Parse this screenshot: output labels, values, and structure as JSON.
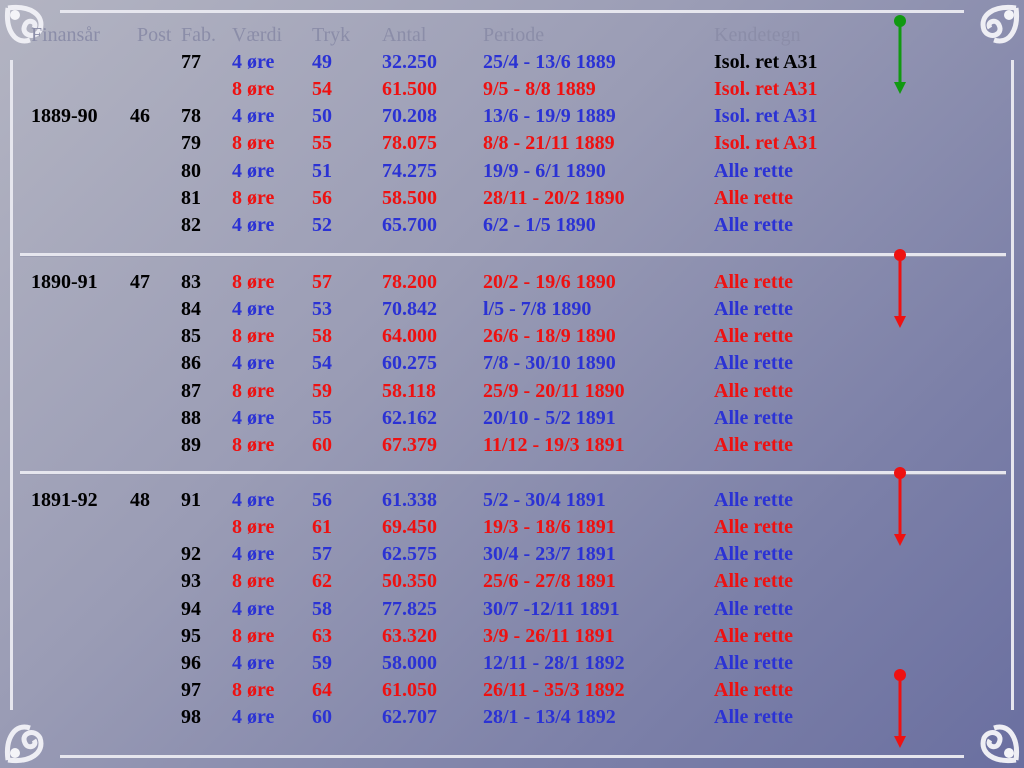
{
  "colors": {
    "blue": "#2b32d4",
    "red": "#ee1111",
    "black": "#000000",
    "green": "#119911",
    "header": "#8b8da8"
  },
  "header": {
    "finansaar": "Finansår",
    "post": "Post",
    "fab": "Fab.",
    "vaerdi": "Værdi",
    "tryk": "Tryk",
    "antal": "Antal",
    "periode": "Periode",
    "kendetegn": "Kendetegn"
  },
  "rows": [
    {
      "fin": "",
      "post": "",
      "fab": "77",
      "val": "4 øre",
      "tryk": "49",
      "antal": "32.250",
      "per": "25/4 - 13/6 1889",
      "ken": "Isol. ret A31",
      "color": "blue",
      "ken_color": "black"
    },
    {
      "fin": "",
      "post": "",
      "fab": "",
      "val": "8 øre",
      "tryk": "54",
      "antal": "61.500",
      "per": "9/5 - 8/8 1889",
      "ken": "Isol. ret A31",
      "color": "red",
      "ken_color": "red"
    },
    {
      "fin": "1889-90",
      "post": "46",
      "fab": "78",
      "val": "4 øre",
      "tryk": "50",
      "antal": "70.208",
      "per": "13/6 - 19/9 1889",
      "ken": "Isol. ret A31",
      "color": "blue",
      "ken_color": "blue"
    },
    {
      "fin": "",
      "post": "",
      "fab": "79",
      "val": "8 øre",
      "tryk": "55",
      "antal": "78.075",
      "per": "8/8 - 21/11 1889",
      "ken": "Isol. ret A31",
      "color": "red",
      "ken_color": "red"
    },
    {
      "fin": "",
      "post": "",
      "fab": "80",
      "val": "4 øre",
      "tryk": "51",
      "antal": "74.275",
      "per": "19/9 - 6/1 1890",
      "ken": "Alle rette",
      "color": "blue",
      "ken_color": "blue"
    },
    {
      "fin": "",
      "post": "",
      "fab": "81",
      "val": "8 øre",
      "tryk": "56",
      "antal": "58.500",
      "per": "28/11 - 20/2 1890",
      "ken": "Alle rette",
      "color": "red",
      "ken_color": "red"
    },
    {
      "fin": "",
      "post": "",
      "fab": "82",
      "val": "4 øre",
      "tryk": "52",
      "antal": "65.700",
      "per": "6/2 - 1/5 1890",
      "ken": "Alle rette",
      "color": "blue",
      "ken_color": "blue"
    },
    {
      "fin": "1890-91",
      "post": "47",
      "fab": "83",
      "val": "8 øre",
      "tryk": "57",
      "antal": "78.200",
      "per": "20/2 - 19/6 1890",
      "ken": "Alle rette",
      "color": "red",
      "ken_color": "red"
    },
    {
      "fin": "",
      "post": "",
      "fab": "84",
      "val": "4 øre",
      "tryk": "53",
      "antal": "70.842",
      "per": "l/5 - 7/8 1890",
      "ken": "Alle rette",
      "color": "blue",
      "ken_color": "blue"
    },
    {
      "fin": "",
      "post": "",
      "fab": "85",
      "val": "8 øre",
      "tryk": "58",
      "antal": "64.000",
      "per": "26/6 - 18/9 1890",
      "ken": "Alle rette",
      "color": "red",
      "ken_color": "red"
    },
    {
      "fin": "",
      "post": "",
      "fab": "86",
      "val": "4 øre",
      "tryk": "54",
      "antal": "60.275",
      "per": "7/8 - 30/10 1890",
      "ken": "Alle rette",
      "color": "blue",
      "ken_color": "blue"
    },
    {
      "fin": "",
      "post": "",
      "fab": "87",
      "val": "8 øre",
      "tryk": "59",
      "antal": "58.118",
      "per": "25/9 - 20/11 1890",
      "ken": "Alle rette",
      "color": "red",
      "ken_color": "red"
    },
    {
      "fin": "",
      "post": "",
      "fab": "88",
      "val": "4 øre",
      "tryk": "55",
      "antal": "62.162",
      "per": "20/10 - 5/2 1891",
      "ken": "Alle rette",
      "color": "blue",
      "ken_color": "blue"
    },
    {
      "fin": "",
      "post": "",
      "fab": "89",
      "val": "8 øre",
      "tryk": "60",
      "antal": "67.379",
      "per": "11/12 - 19/3 1891",
      "ken": "Alle rette",
      "color": "red",
      "ken_color": "red"
    },
    {
      "fin": "1891-92",
      "post": "48",
      "fab": "91",
      "val": "4 øre",
      "tryk": "56",
      "antal": "61.338",
      "per": "5/2 - 30/4 1891",
      "ken": "Alle rette",
      "color": "blue",
      "ken_color": "blue"
    },
    {
      "fin": "",
      "post": "",
      "fab": "",
      "val": "8 øre",
      "tryk": "61",
      "antal": "69.450",
      "per": "19/3 - 18/6 1891",
      "ken": "Alle rette",
      "color": "red",
      "ken_color": "red"
    },
    {
      "fin": "",
      "post": "",
      "fab": "92",
      "val": "4 øre",
      "tryk": "57",
      "antal": "62.575",
      "per": "30/4 - 23/7 1891",
      "ken": "Alle rette",
      "color": "blue",
      "ken_color": "blue"
    },
    {
      "fin": "",
      "post": "",
      "fab": "93",
      "val": "8 øre",
      "tryk": "62",
      "antal": "50.350",
      "per": "25/6 - 27/8 1891",
      "ken": "Alle rette",
      "color": "red",
      "ken_color": "red"
    },
    {
      "fin": "",
      "post": "",
      "fab": "94",
      "val": "4 øre",
      "tryk": "58",
      "antal": "77.825",
      "per": "30/7 -12/11 1891",
      "ken": "Alle rette",
      "color": "blue",
      "ken_color": "blue"
    },
    {
      "fin": "",
      "post": "",
      "fab": "95",
      "val": "8 øre",
      "tryk": "63",
      "antal": "63.320",
      "per": "3/9 - 26/11 1891",
      "ken": "Alle rette",
      "color": "red",
      "ken_color": "red"
    },
    {
      "fin": "",
      "post": "",
      "fab": "96",
      "val": "4 øre",
      "tryk": "59",
      "antal": "58.000",
      "per": "12/11 - 28/1 1892",
      "ken": "Alle rette",
      "color": "blue",
      "ken_color": "blue"
    },
    {
      "fin": "",
      "post": "",
      "fab": "97",
      "val": "8 øre",
      "tryk": "64",
      "antal": "61.050",
      "per": "26/11 - 35/3 1892",
      "ken": "Alle rette",
      "color": "red",
      "ken_color": "red"
    },
    {
      "fin": "",
      "post": "",
      "fab": "98",
      "val": "4 øre",
      "tryk": "60",
      "antal": "62.707",
      "per": "28/1 - 13/4 1892",
      "ken": "Alle rette",
      "color": "blue",
      "ken_color": "blue"
    }
  ],
  "arrows": [
    {
      "name": "green-down-arrow",
      "color": "green"
    },
    {
      "name": "red-down-arrow",
      "color": "red"
    },
    {
      "name": "red-down-arrow",
      "color": "red"
    },
    {
      "name": "red-down-arrow",
      "color": "red"
    }
  ]
}
